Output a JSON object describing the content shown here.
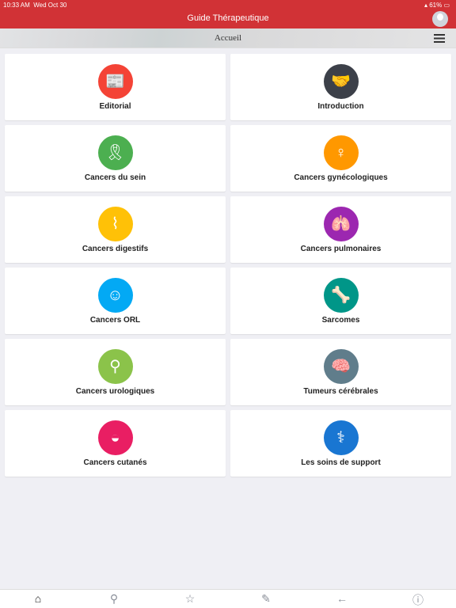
{
  "status": {
    "time": "10:33 AM",
    "date": "Wed Oct 30",
    "battery": "61%"
  },
  "header": {
    "title": "Guide Thérapeutique"
  },
  "subheader": {
    "title": "Accueil"
  },
  "cards": [
    {
      "label": "Editorial",
      "icon": "newspaper-icon",
      "color": "#f44336",
      "glyph": "📰"
    },
    {
      "label": "Introduction",
      "icon": "handshake-icon",
      "color": "#3c4049",
      "glyph": "🤝"
    },
    {
      "label": "Cancers du sein",
      "icon": "ribbon-icon",
      "color": "#4caf50",
      "glyph": "🎗"
    },
    {
      "label": "Cancers gynécologiques",
      "icon": "uterus-icon",
      "color": "#ff9800",
      "glyph": "♀"
    },
    {
      "label": "Cancers digestifs",
      "icon": "intestine-icon",
      "color": "#ffc107",
      "glyph": "⌇"
    },
    {
      "label": "Cancers pulmonaires",
      "icon": "lungs-icon",
      "color": "#9c27b0",
      "glyph": "🫁"
    },
    {
      "label": "Cancers ORL",
      "icon": "head-profile-icon",
      "color": "#03a9f4",
      "glyph": "☺"
    },
    {
      "label": "Sarcomes",
      "icon": "bone-joint-icon",
      "color": "#009688",
      "glyph": "🦴"
    },
    {
      "label": "Cancers urologiques",
      "icon": "kidneys-icon",
      "color": "#8bc34a",
      "glyph": "⚲"
    },
    {
      "label": "Tumeurs cérébrales",
      "icon": "brain-icon",
      "color": "#607d8b",
      "glyph": "🧠"
    },
    {
      "label": "Cancers cutanés",
      "icon": "skin-icon",
      "color": "#e91e63",
      "glyph": "◒"
    },
    {
      "label": "Les soins de support",
      "icon": "doctor-icon",
      "color": "#1976d2",
      "glyph": "⚕"
    }
  ],
  "tabbar": [
    {
      "name": "home-icon",
      "glyph": "⌂",
      "active": true
    },
    {
      "name": "search-icon",
      "glyph": "⚲"
    },
    {
      "name": "star-icon",
      "glyph": "☆"
    },
    {
      "name": "edit-icon",
      "glyph": "✎"
    },
    {
      "name": "back-arrow-icon",
      "glyph": "←"
    },
    {
      "name": "info-icon",
      "glyph": "ⓘ"
    }
  ]
}
